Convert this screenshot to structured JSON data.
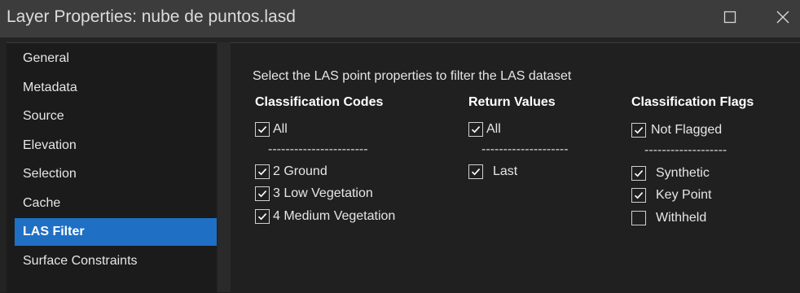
{
  "window": {
    "title": "Layer Properties: nube de puntos.lasd",
    "maximize_icon": "maximize-icon",
    "close_icon": "close-icon"
  },
  "sidebar": {
    "items": [
      {
        "label": "General",
        "active": false
      },
      {
        "label": "Metadata",
        "active": false
      },
      {
        "label": "Source",
        "active": false
      },
      {
        "label": "Elevation",
        "active": false
      },
      {
        "label": "Selection",
        "active": false
      },
      {
        "label": "Cache",
        "active": false
      },
      {
        "label": "LAS Filter",
        "active": true
      },
      {
        "label": "Surface Constraints",
        "active": false
      }
    ]
  },
  "las_filter": {
    "intro": "Select the LAS point properties to filter the LAS dataset",
    "separators": {
      "classification_codes": "-----------------------",
      "return_values": "--------------------",
      "classification_flags": "-------------------"
    },
    "classification_codes": {
      "heading": "Classification Codes",
      "all": {
        "label": "All",
        "checked": true
      },
      "items": [
        {
          "label": "2 Ground",
          "checked": true
        },
        {
          "label": "3 Low Vegetation",
          "checked": true
        },
        {
          "label": "4 Medium Vegetation",
          "checked": true
        }
      ]
    },
    "return_values": {
      "heading": "Return Values",
      "all": {
        "label": "All",
        "checked": true
      },
      "items": [
        {
          "label": "Last",
          "checked": true
        }
      ]
    },
    "classification_flags": {
      "heading": "Classification Flags",
      "all": {
        "label": "Not Flagged",
        "checked": true
      },
      "items": [
        {
          "label": "Synthetic",
          "checked": true
        },
        {
          "label": "Key Point",
          "checked": true
        },
        {
          "label": "Withheld",
          "checked": false
        }
      ]
    }
  },
  "colors": {
    "accent": "#1f6fc5",
    "title_bar": "#3c3c3c",
    "background": "#202020"
  }
}
